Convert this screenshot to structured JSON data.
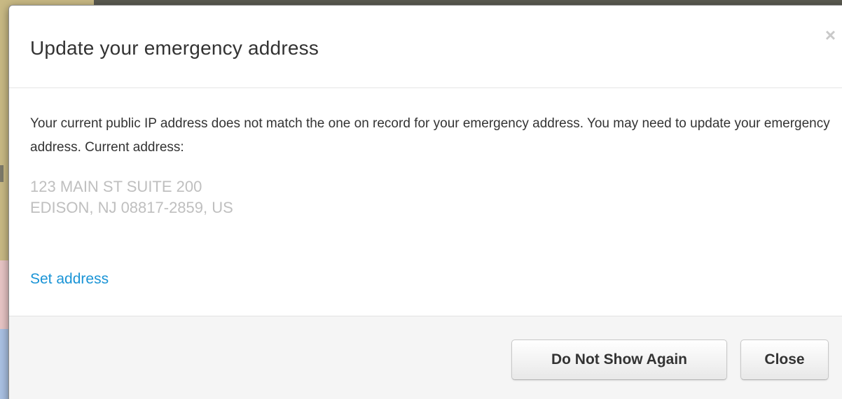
{
  "dialog": {
    "title": "Update your emergency address",
    "close_glyph": "×",
    "message": "Your current public IP address does not match the one on record for your emergency address. You may need to update your emergency address. Current address:",
    "address_line1": "123 MAIN ST SUITE 200",
    "address_line2": "EDISON, NJ 08817-2859, US",
    "set_address_link": "Set address",
    "buttons": {
      "do_not_show_again": "Do Not Show Again",
      "close": "Close"
    }
  },
  "colors": {
    "link": "#1a94d6",
    "title_text": "#333333",
    "address_text": "#bfbfbf",
    "footer_bg": "#f5f5f5"
  },
  "icons": {
    "close": "close-icon"
  }
}
